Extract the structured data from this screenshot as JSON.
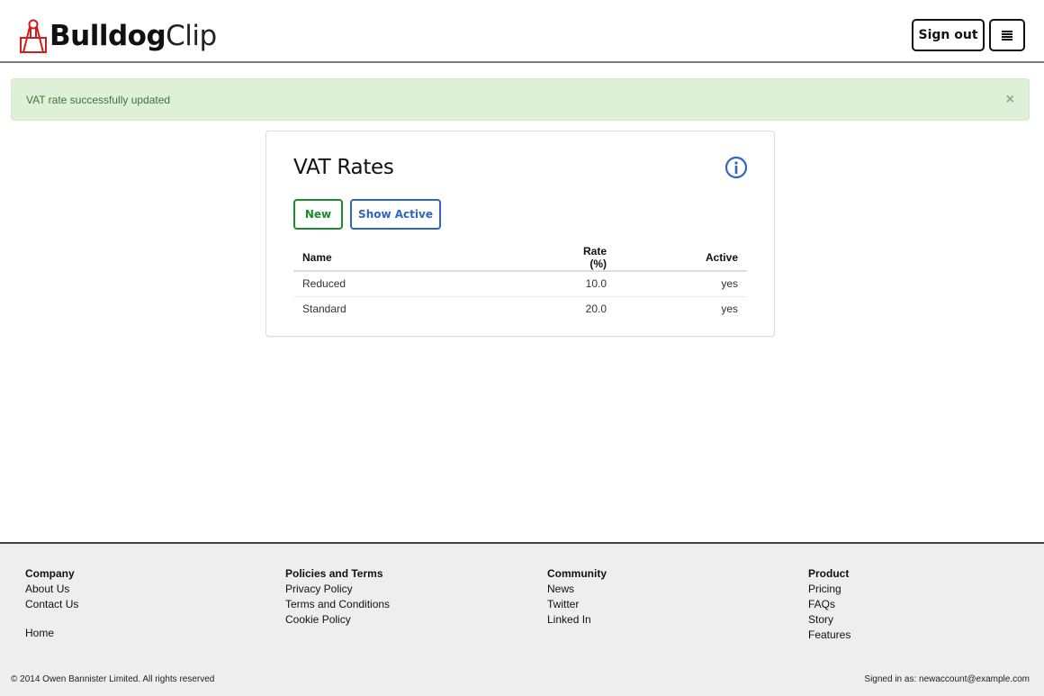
{
  "header": {
    "logo_bold": "Bulldog",
    "logo_light": "Clip",
    "signout_label": "Sign out",
    "menu_icon": "hamburger-menu-icon",
    "logo_color": "#cc1f1f"
  },
  "alert": {
    "message": "VAT rate successfully updated",
    "close_label": "×",
    "type": "success"
  },
  "panel": {
    "title": "VAT Rates",
    "info_icon": "info-circle-icon",
    "buttons": {
      "new_label": "New",
      "show_active_label": "Show Active"
    },
    "table": {
      "columns": [
        "Name",
        "Rate (%)",
        "Active"
      ],
      "rows": [
        [
          "Reduced",
          "10.0",
          "yes"
        ],
        [
          "Standard",
          "20.0",
          "yes"
        ]
      ]
    }
  },
  "footer": {
    "columns": [
      {
        "heading": "Company",
        "links": [
          "About Us",
          "Contact Us"
        ],
        "extra": "Home"
      },
      {
        "heading": "Policies and Terms",
        "links": [
          "Privacy Policy",
          "Terms and Conditions",
          "Cookie Policy"
        ]
      },
      {
        "heading": "Community",
        "links": [
          "News",
          "Twitter",
          "Linked In"
        ]
      },
      {
        "heading": "Product",
        "links": [
          "Pricing",
          "FAQs",
          "Story",
          "Features"
        ]
      }
    ],
    "copyright": "© 2014 Owen Bannister Limited. All rights reserved",
    "signed_in": "Signed in as: newaccount@example.com"
  },
  "colors": {
    "success_bg": "#dff0d8",
    "success_text": "#3c763d",
    "new_button": "#1e8a2e",
    "show_active_button": "#2f64c2",
    "info_icon": "#2f64c2"
  }
}
